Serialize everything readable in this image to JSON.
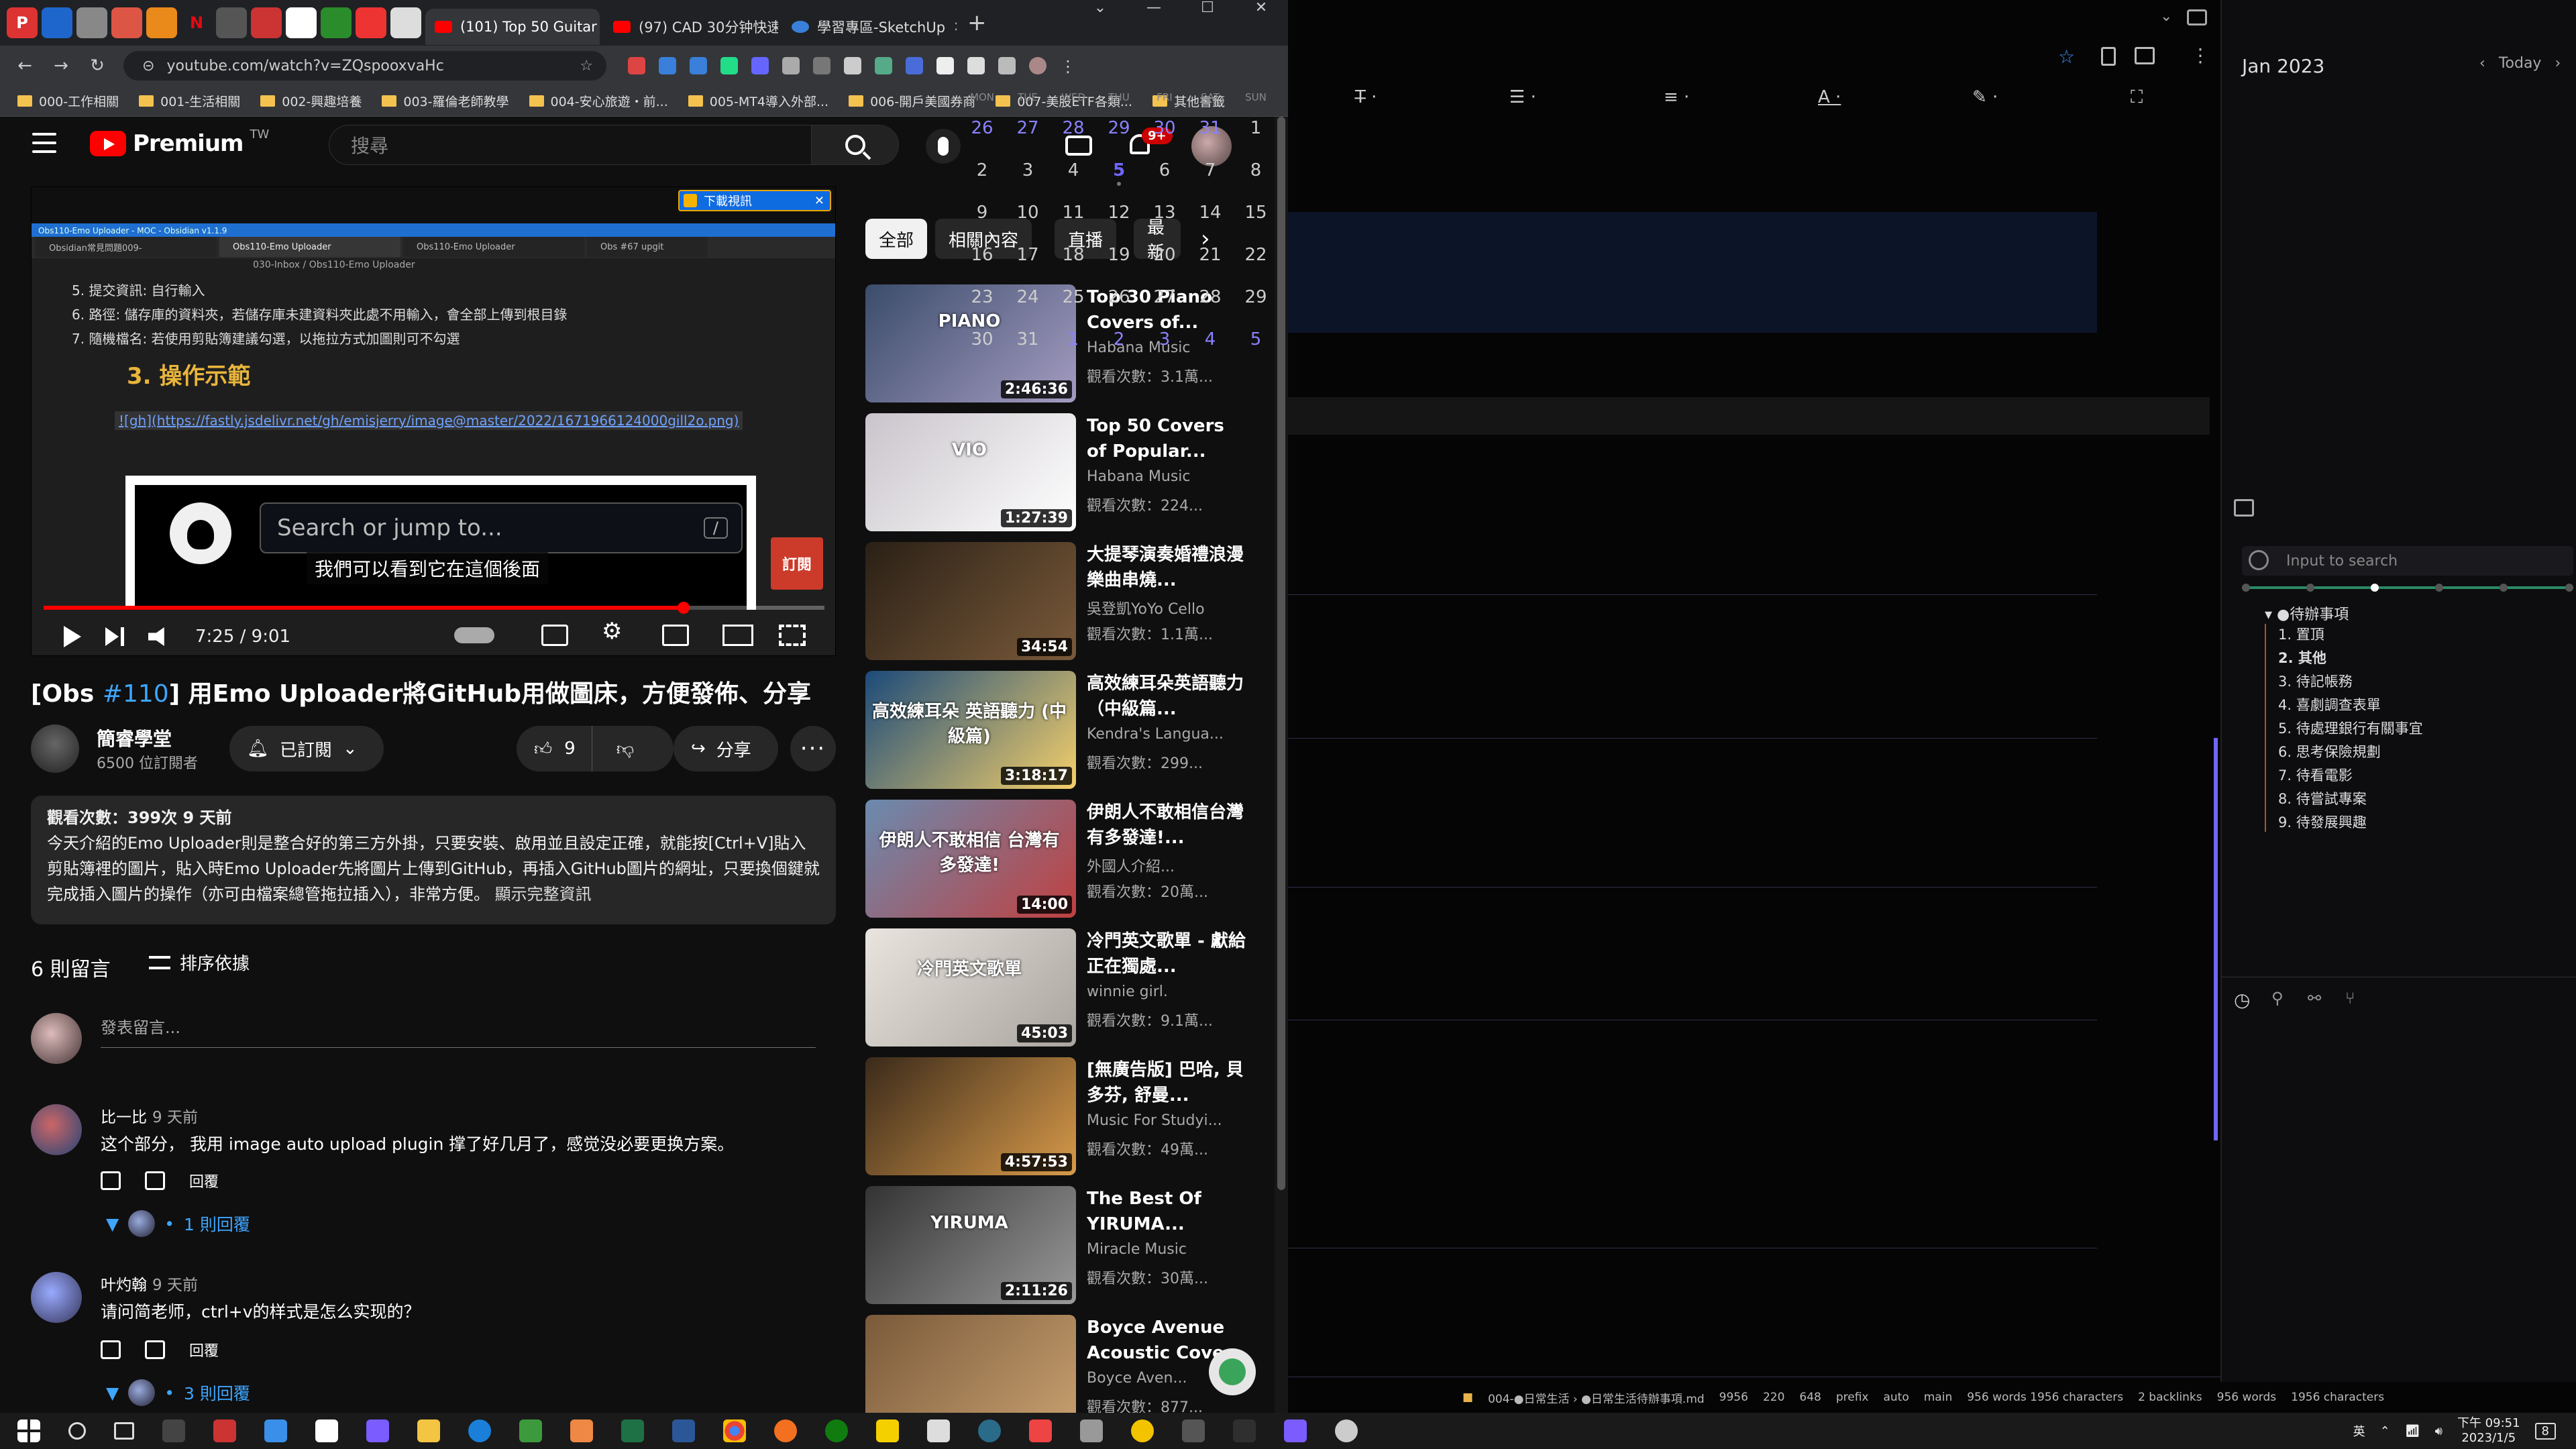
{
  "chrome": {
    "tabs": [
      {
        "label": "(101) Top 50 Guitar",
        "active": true
      },
      {
        "label": "(97) CAD 30分钟快速",
        "active": false
      },
      {
        "label": "學習專區-SketchUp",
        "active": false
      }
    ],
    "url": "youtube.com/watch?v=ZQspooxvaHc",
    "bookmarks": [
      "000-工作相關",
      "001-生活相關",
      "002-興趣培養",
      "003-羅倫老師教學",
      "004-安心旅遊・前...",
      "005-MT4導入外部...",
      "006-開戶美國券商",
      "007-美股ETF各類...",
      "其他書籤"
    ]
  },
  "youtube": {
    "brand": "Premium",
    "region": "TW",
    "search_placeholder": "搜尋",
    "notif_count": "9+",
    "download_label": "下載視訊",
    "player": {
      "obs_title": "Obs110-Emo Uploader - MOC - Obsidian v1.1.9",
      "tabs": [
        "Obsidian常見問題009-",
        "Obs110-Emo Uploader",
        "Obs110-Emo Uploader",
        "Obs #67 upgit"
      ],
      "breadcrumb": "030-Inbox / Obs110-Emo Uploader",
      "lines": [
        "5. 提交資訊: 自行輸入",
        "6. 路徑: 儲存庫的資料夾，若儲存庫未建資料夾此處不用輸入，會全部上傳到根目錄",
        "7. 隨機檔名: 若使用剪貼簿建議勾選，以拖拉方式加圖則可不勾選"
      ],
      "heading": "3. 操作示範",
      "link": "![gh](https://fastly.jsdelivr.net/gh/emisjerry/image@master/2022/1671966124000gill2o.png)",
      "github_search": "Search or jump to...",
      "subtitle": "我們可以看到它在這個後面",
      "subscribe_corner": "訂閱",
      "time": "7:25 / 9:01",
      "progress": 0.82
    },
    "video": {
      "title_prefix": "[Obs ",
      "title_hash": "#110",
      "title_rest": "] 用Emo Uploader將GitHub用做圖床，方便發佈、分享",
      "channel": "簡睿學堂",
      "subscribers": "6500 位訂閱者",
      "subscribed_label": "已訂閱",
      "likes": "9",
      "share_label": "分享",
      "views_line": "觀看次數：399次  9 天前",
      "description": "今天介紹的Emo Uploader則是整合好的第三方外掛，只要安裝、啟用並且設定正確，就能按[Ctrl+V]貼入剪貼簿裡的圖片，貼入時Emo Uploader先將圖片上傳到GitHub，再插入GitHub圖片的網址，只要換個鍵就完成插入圖片的操作（亦可由檔案總管拖拉插入），非常方便。",
      "show_more": "顯示完整資訊"
    },
    "comments": {
      "count_label": "6 則留言",
      "sort_label": "排序依據",
      "add_placeholder": "發表留言...",
      "items": [
        {
          "author": "比一比",
          "time": "9 天前",
          "text": "这个部分， 我用 image auto upload plugin 撑了好几月了，感觉没必要更换方案。",
          "reply": "回覆",
          "replies": "1 則回覆"
        },
        {
          "author": "叶灼翰",
          "time": "9 天前",
          "text": "请问简老师，ctrl+v的样式是怎么实现的？",
          "reply": "回覆",
          "replies": "3 則回覆"
        }
      ]
    },
    "chips": [
      "全部",
      "相關內容",
      "直播",
      "最新"
    ],
    "recommendations": [
      {
        "title": "Top 30 Piano Covers of...",
        "channel": "Habana Music",
        "views": "觀看次數：3.1萬...",
        "duration": "2:46:36"
      },
      {
        "title": "Top 50 Covers of Popular...",
        "channel": "Habana Music",
        "views": "觀看次數：224...",
        "duration": "1:27:39"
      },
      {
        "title": "大提琴演奏婚禮浪漫樂曲串燒...",
        "channel": "吳登凱YoYo Cello",
        "views": "觀看次數：1.1萬...",
        "duration": "34:54"
      },
      {
        "title": "高效練耳朵英語聽力（中級篇...",
        "channel": "Kendra's Langua...",
        "views": "觀看次數：299...",
        "duration": "3:18:17"
      },
      {
        "title": "伊朗人不敢相信台灣有多發達!...",
        "channel": "外國人介紹...",
        "views": "觀看次數：20萬...",
        "duration": "14:00"
      },
      {
        "title": "冷門英文歌單 - 獻給正在獨處...",
        "channel": "winnie girl.",
        "views": "觀看次數：9.1萬...",
        "duration": "45:03"
      },
      {
        "title": "[無廣告版] 巴哈, 貝多芬, 舒曼...",
        "channel": "Music For Studyi...",
        "views": "觀看次數：49萬...",
        "duration": "4:57:53"
      },
      {
        "title": "The Best Of YIRUMA...",
        "channel": "Miracle Music",
        "views": "觀看次數：30萬...",
        "duration": "2:11:26"
      },
      {
        "title": "Boyce Avenue Acoustic Cove...",
        "channel": "Boyce Aven...",
        "views": "觀看次數：877...",
        "duration": ""
      }
    ],
    "thumb_texts": [
      "PIANO",
      "VIO",
      "",
      "高效練耳朵 英語聽力 (中級篇)",
      "伊朗人不敢相信 台灣有多發達!",
      "冷門英文歌單",
      "",
      "YIRUMA",
      ""
    ]
  },
  "obsidian": {
    "calendar": {
      "month": "Jan 2023",
      "today_label": "Today",
      "dow": [
        "MON",
        "TUE",
        "WED",
        "THU",
        "FRI",
        "SAT",
        "SUN"
      ],
      "weeks": [
        [
          "26",
          "27",
          "28",
          "29",
          "30",
          "31",
          "1"
        ],
        [
          "2",
          "3",
          "4",
          "5",
          "6",
          "7",
          "8"
        ],
        [
          "9",
          "10",
          "11",
          "12",
          "13",
          "14",
          "15"
        ],
        [
          "16",
          "17",
          "18",
          "19",
          "20",
          "21",
          "22"
        ],
        [
          "23",
          "24",
          "25",
          "26",
          "27",
          "28",
          "29"
        ],
        [
          "30",
          "31",
          "1",
          "2",
          "3",
          "4",
          "5"
        ]
      ]
    },
    "search_placeholder": "Input to search",
    "outline_root": "●待辦事項",
    "outline": [
      "1. 置頂",
      "2. 其他",
      "3. 待記帳務",
      "4. 喜劇調查表單",
      "5. 待處理銀行有關事宜",
      "6. 思考保險規劃",
      "7. 待看電影",
      "8. 待嘗試專案",
      "9. 待發展興趣"
    ],
    "status": [
      "004-●日常生活 › ●日常生活待辦事項.md",
      "9956",
      "220",
      "648",
      "prefix",
      "auto",
      "main",
      "956 words 1956 characters",
      "2 backlinks",
      "956 words",
      "1956 characters"
    ]
  },
  "taskbar": {
    "ime": "英",
    "time": "下午 09:51",
    "date": "2023/1/5",
    "notif": "8"
  },
  "colors": {
    "yt_red": "#ff0000",
    "link_blue": "#3ea6ff",
    "obsidian_accent": "#8a82ff",
    "obsidian_purple_line": "#6f66ff"
  }
}
